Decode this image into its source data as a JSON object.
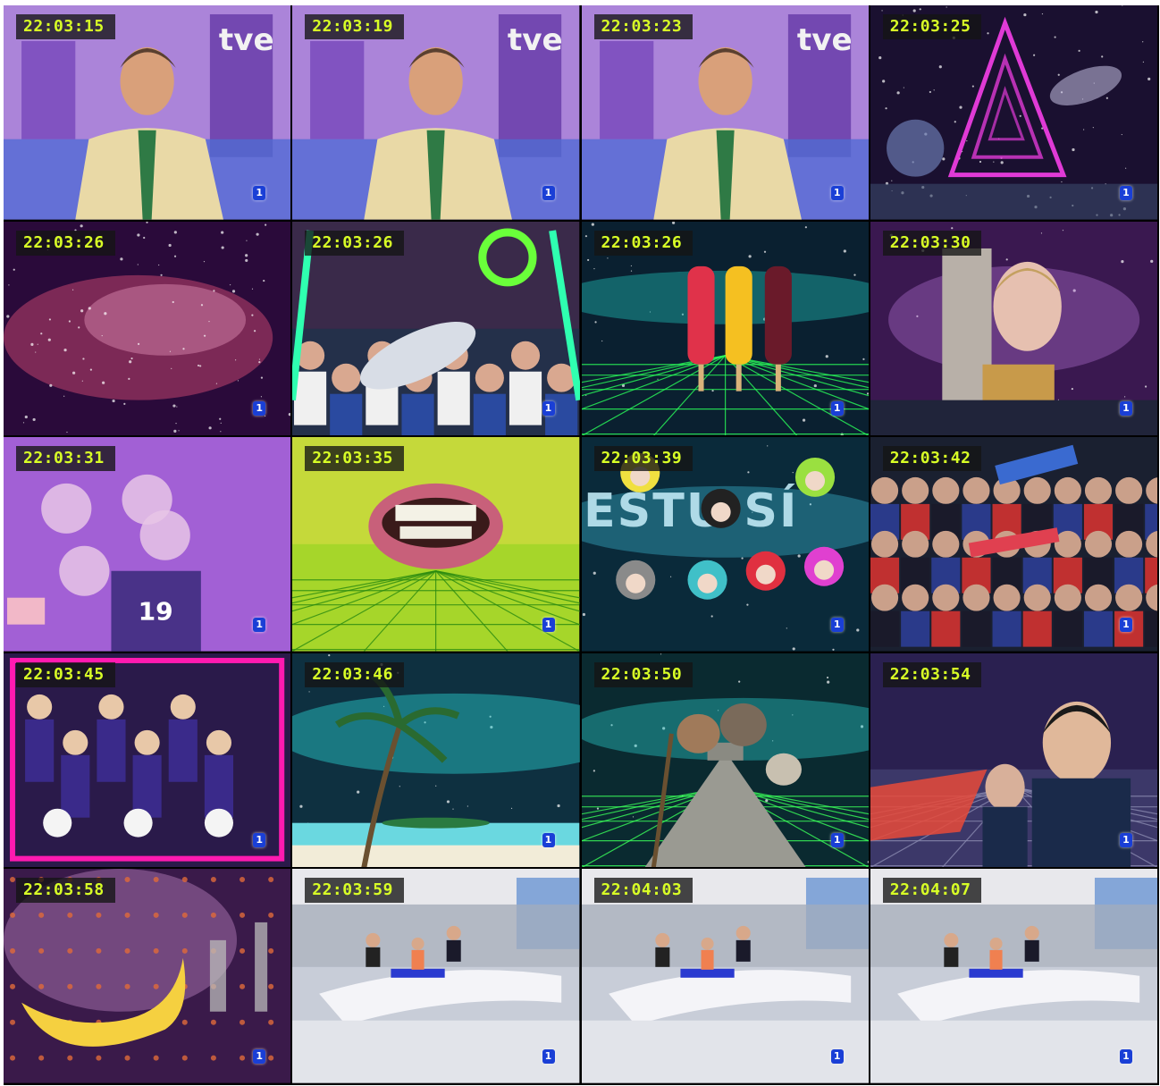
{
  "frames": [
    {
      "time": "22:03:15",
      "scene": "news-anchor-studio",
      "bg": "#8a5bc9",
      "accent": "#e9d9a6"
    },
    {
      "time": "22:03:19",
      "scene": "news-anchor-studio",
      "bg": "#8a5bc9",
      "accent": "#e9d9a6"
    },
    {
      "time": "22:03:23",
      "scene": "news-anchor-studio",
      "bg": "#8a5bc9",
      "accent": "#e9d9a6"
    },
    {
      "time": "22:03:25",
      "scene": "neon-triangle-space",
      "bg": "#1a1030",
      "accent": "#e03ad6"
    },
    {
      "time": "22:03:26",
      "scene": "pink-nebula",
      "bg": "#2a0a3a",
      "accent": "#e0507a"
    },
    {
      "time": "22:03:26",
      "scene": "crowd-with-inflatable",
      "bg": "#3a2a4a",
      "accent": "#2fffb0"
    },
    {
      "time": "22:03:26",
      "scene": "popsicles-on-grid",
      "bg": "#0a2030",
      "accent": "#f5c021"
    },
    {
      "time": "22:03:30",
      "scene": "face-on-building",
      "bg": "#3a1850",
      "accent": "#c07ae0"
    },
    {
      "time": "22:03:31",
      "scene": "kids-pink-filter",
      "bg": "#b35bd0",
      "accent": "#7b6ee0"
    },
    {
      "time": "22:03:35",
      "scene": "mouth-on-green-grid",
      "bg": "#a6d62a",
      "accent": "#ffe05a"
    },
    {
      "time": "22:03:39",
      "scene": "afro-heads-text",
      "bg": "#0a2a3a",
      "accent": "#4de0ff"
    },
    {
      "time": "22:03:42",
      "scene": "stadium-crowd",
      "bg": "#1a2030",
      "accent": "#3a6ad0"
    },
    {
      "time": "22:03:45",
      "scene": "cheerleaders-pink-frame",
      "bg": "#2a1a4a",
      "accent": "#ff1ab0"
    },
    {
      "time": "22:03:46",
      "scene": "palm-beach-space",
      "bg": "#0e3040",
      "accent": "#2ad0d0"
    },
    {
      "time": "22:03:50",
      "scene": "pyramid-animals-grid",
      "bg": "#0a2a30",
      "accent": "#3aff5a"
    },
    {
      "time": "22:03:54",
      "scene": "leader-on-grid",
      "bg": "#2a2050",
      "accent": "#e84a3a"
    },
    {
      "time": "22:03:58",
      "scene": "banana-space",
      "bg": "#3a1a4a",
      "accent": "#f5d040"
    },
    {
      "time": "22:03:59",
      "scene": "news-desk-studio",
      "bg": "#c8cdd8",
      "accent": "#2a3ad0"
    },
    {
      "time": "22:04:03",
      "scene": "news-desk-studio",
      "bg": "#c8cdd8",
      "accent": "#2a3ad0"
    },
    {
      "time": "22:04:07",
      "scene": "news-desk-studio",
      "bg": "#c8cdd8",
      "accent": "#2a3ad0"
    }
  ],
  "channel_logo": "1"
}
